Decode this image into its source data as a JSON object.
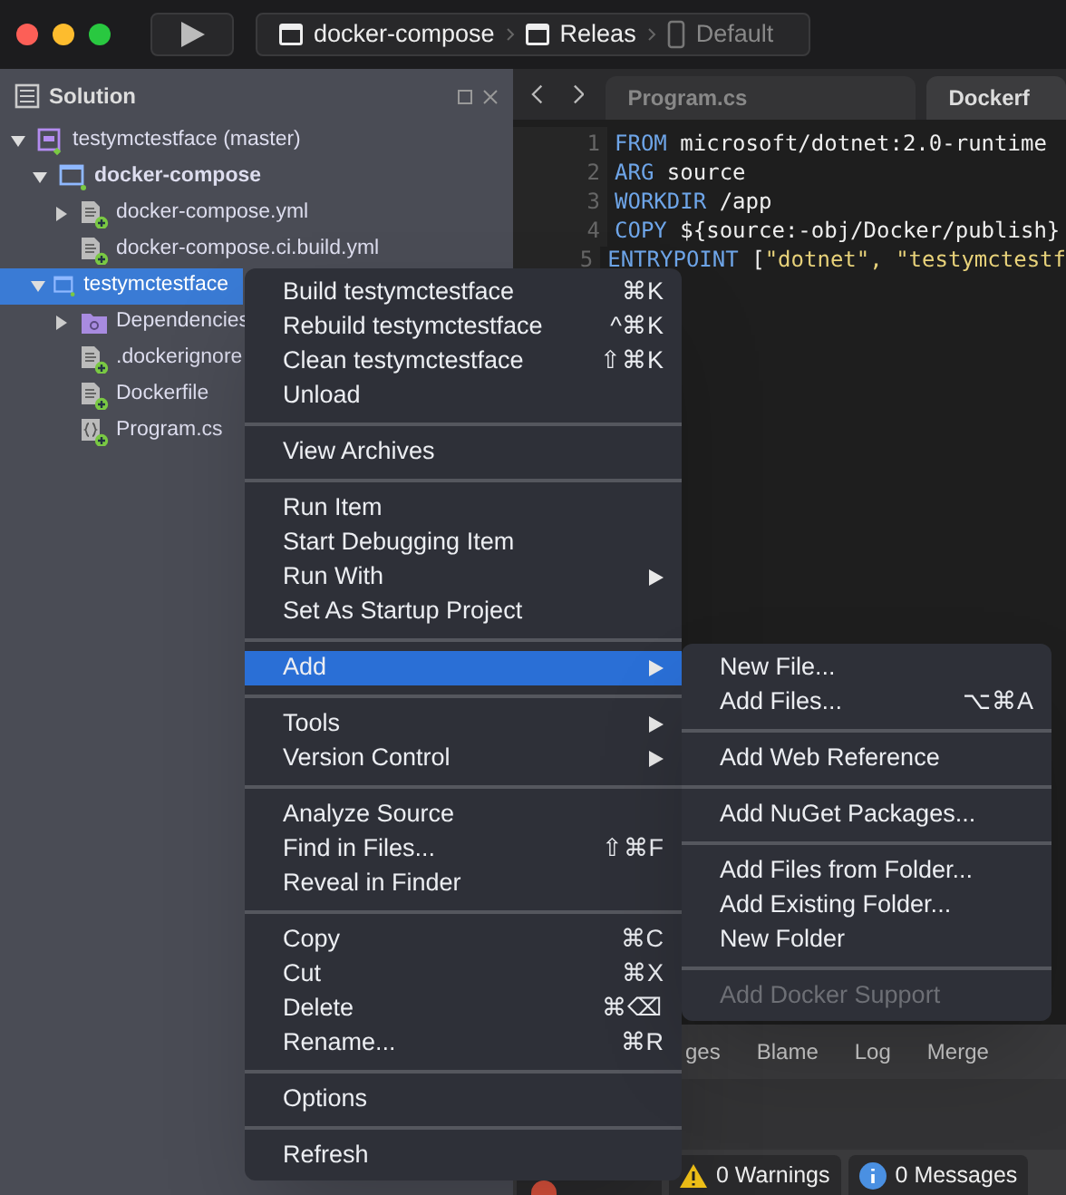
{
  "toolbar": {
    "breadcrumbs": [
      {
        "label": "docker-compose",
        "kind": "window"
      },
      {
        "label": "Releas",
        "kind": "window"
      },
      {
        "label": "Default",
        "kind": "device"
      }
    ]
  },
  "solution": {
    "title": "Solution",
    "tree": [
      {
        "label": "testymctestface (master)",
        "kind": "solution",
        "expanded": true,
        "selected": false,
        "bold": false,
        "children": [
          {
            "label": "docker-compose",
            "kind": "project",
            "expanded": true,
            "selected": false,
            "bold": true,
            "children": [
              {
                "label": "docker-compose.yml",
                "kind": "file",
                "expanded": false,
                "selected": false,
                "bold": false
              },
              {
                "label": "docker-compose.ci.build.yml",
                "kind": "file",
                "selected": false,
                "bold": false
              }
            ]
          },
          {
            "label": "testymctestface",
            "kind": "project",
            "expanded": true,
            "selected": true,
            "bold": false,
            "children": [
              {
                "label": "Dependencies",
                "kind": "folder",
                "expanded": false,
                "selected": false,
                "bold": false
              },
              {
                "label": ".dockerignore",
                "kind": "file",
                "selected": false,
                "bold": false
              },
              {
                "label": "Dockerfile",
                "kind": "file",
                "selected": false,
                "bold": false
              },
              {
                "label": "Program.cs",
                "kind": "code",
                "selected": false,
                "bold": false
              }
            ]
          }
        ]
      }
    ]
  },
  "editor": {
    "tabs": [
      {
        "label": "Program.cs",
        "selected": false
      },
      {
        "label": "Dockerf",
        "selected": true
      }
    ],
    "lines": [
      {
        "number": "1",
        "keyword": "FROM",
        "rest": "microsoft/dotnet:2.0-runtime"
      },
      {
        "number": "2",
        "keyword": "ARG",
        "rest": "source"
      },
      {
        "number": "3",
        "keyword": "WORKDIR",
        "rest": "/app"
      },
      {
        "number": "4",
        "keyword": "COPY",
        "rest": "${source:-obj/Docker/publish}"
      },
      {
        "number": "5",
        "keyword": "ENTRYPOINT",
        "rest": "[",
        "strings": "\"dotnet\", \"testymctestf"
      }
    ]
  },
  "bottom_pad": {
    "tabs": [
      "ges",
      "Blame",
      "Log",
      "Merge"
    ],
    "status": [
      {
        "label": "0 Warnings",
        "kind": "warning"
      },
      {
        "label": "0 Messages",
        "kind": "info"
      }
    ]
  },
  "context_menu": {
    "groups": [
      [
        {
          "label": "Build testymctestface",
          "shortcut": "⌘K"
        },
        {
          "label": "Rebuild testymctestface",
          "shortcut": "^⌘K"
        },
        {
          "label": "Clean testymctestface",
          "shortcut": "⇧⌘K"
        },
        {
          "label": "Unload"
        }
      ],
      [
        {
          "label": "View Archives"
        }
      ],
      [
        {
          "label": "Run Item"
        },
        {
          "label": "Start Debugging Item"
        },
        {
          "label": "Run With",
          "submenu": true
        },
        {
          "label": "Set As Startup Project"
        }
      ],
      [
        {
          "label": "Add",
          "submenu": true,
          "selected": true
        }
      ],
      [
        {
          "label": "Tools",
          "submenu": true
        },
        {
          "label": "Version Control",
          "submenu": true
        }
      ],
      [
        {
          "label": "Analyze Source"
        },
        {
          "label": "Find in Files...",
          "shortcut": "⇧⌘F"
        },
        {
          "label": "Reveal in Finder"
        }
      ],
      [
        {
          "label": "Copy",
          "shortcut": "⌘C"
        },
        {
          "label": "Cut",
          "shortcut": "⌘X"
        },
        {
          "label": "Delete",
          "shortcut": "⌘⌫"
        },
        {
          "label": "Rename...",
          "shortcut": "⌘R"
        }
      ],
      [
        {
          "label": "Options"
        }
      ],
      [
        {
          "label": "Refresh"
        }
      ]
    ]
  },
  "submenu": {
    "groups": [
      [
        {
          "label": "New File...",
          "disabled": false
        },
        {
          "label": "Add Files...",
          "shortcut": "⌥⌘A",
          "disabled": false
        }
      ],
      [
        {
          "label": "Add Web Reference",
          "disabled": false
        }
      ],
      [
        {
          "label": "Add NuGet Packages...",
          "disabled": false
        }
      ],
      [
        {
          "label": "Add Files from Folder...",
          "disabled": false
        },
        {
          "label": "Add Existing Folder...",
          "disabled": false
        },
        {
          "label": "New Folder",
          "disabled": false
        }
      ],
      [
        {
          "label": "Add Docker Support",
          "disabled": true
        }
      ]
    ]
  }
}
